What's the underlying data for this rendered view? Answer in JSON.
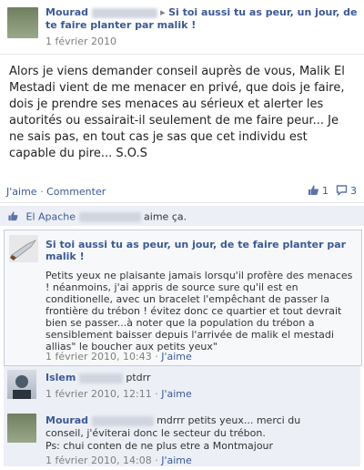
{
  "header": {
    "author": "Mourad",
    "arrow": "▸",
    "title": "Si toi aussi tu as peur, un jour, de te faire planter par malik !",
    "date": "1 février 2010"
  },
  "post": {
    "body": "Alors je viens demander conseil auprès de vous, Malik El Mestadi vient de me menacer en privé, que dois je faire, dois je prendre ses menaces au sérieux et alerter les autorités ou essairait-il seulement de me faire peur... Je ne sais pas, en tout cas je sas que cet individu est capable du pire... S.O.S"
  },
  "actions": {
    "like": "J'aime",
    "dot": "·",
    "comment": "Commenter",
    "like_count": "1",
    "comment_count": "3"
  },
  "likes": {
    "name": "El Apache",
    "text": "aime ça."
  },
  "quote": {
    "title": "Si toi aussi tu as peur, un jour, de te faire planter par malik !",
    "body": "Petits yeux ne plaisante jamais lorsqu'il profère des menaces ! néanmoins, j'ai appris de source sure qu'il est en conditionelle, avec un bracelet l'empêchant de passer la frontière du trébon ! évitez donc ce quartier et tout devrait bien se passer...à noter que la population du trébon a sensiblement baisser depuis l'arrivée de malik el mestadi allias\" le boucher aux petits yeux\"",
    "date": "1 février 2010, 10:43",
    "like": "J'aime"
  },
  "comments": [
    {
      "author": "Islem",
      "text": "ptdrr",
      "date": "1 février 2010, 12:11",
      "like": "J'aime"
    },
    {
      "author": "Mourad",
      "text_line1": "mdrrr petits yeux... merci du",
      "text_line2": "conseil, j'éviterai donc le secteur du trébon.",
      "text_line3": "Ps: chui conten de ne plus etre a Montmajour",
      "date": "1 février 2010, 14:08",
      "like": "J'aime"
    }
  ],
  "colors": {
    "link": "#3b5998",
    "likes_bar": "#eceff5",
    "muted": "#808080"
  }
}
